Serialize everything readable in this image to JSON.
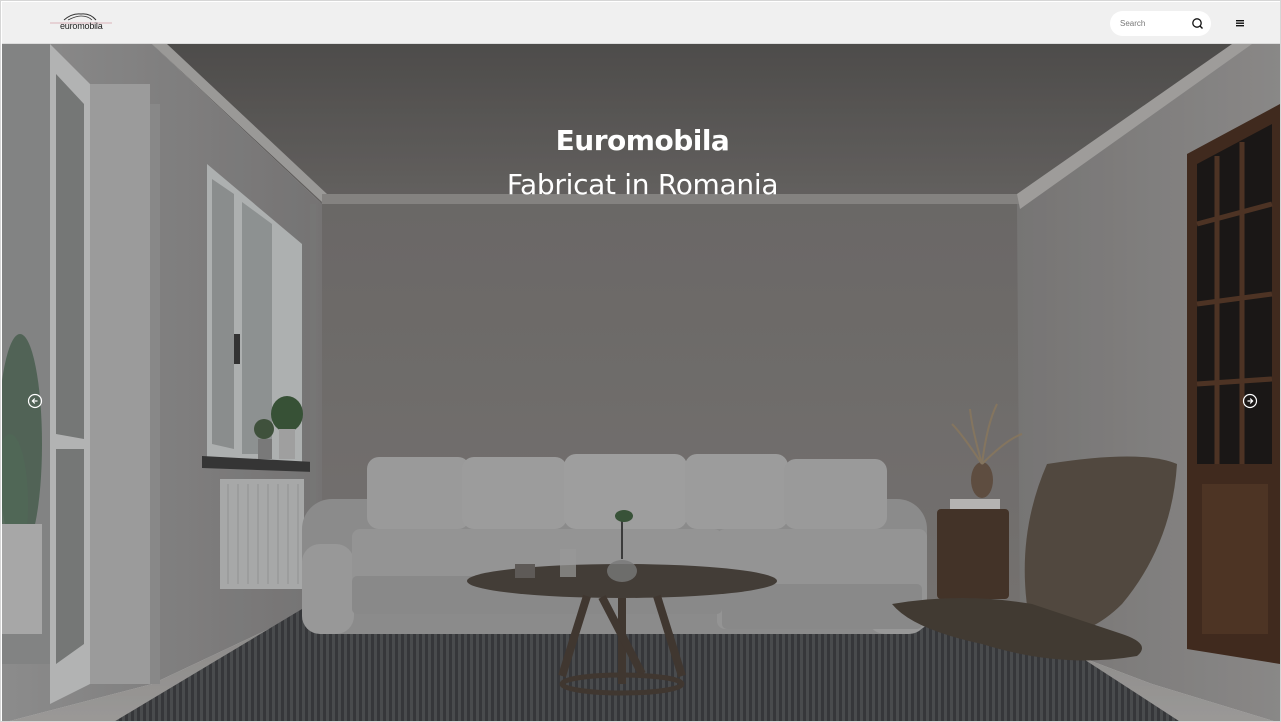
{
  "header": {
    "logo_text": "euromobila",
    "search_placeholder": "Search",
    "search_icon": "search-icon",
    "menu_icon": "hamburger-menu-icon"
  },
  "hero": {
    "title": "Euromobila",
    "subtitle": "Fabricat in Romania",
    "prev_icon": "arrow-left-circle-icon",
    "next_icon": "arrow-right-circle-icon"
  },
  "colors": {
    "header_bg": "#f0f0f0",
    "hero_text": "#ffffff"
  }
}
